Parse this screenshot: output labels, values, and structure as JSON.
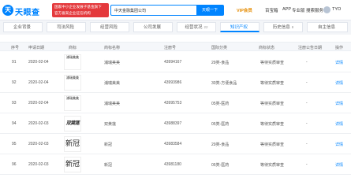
{
  "header": {
    "logo_mark": "天",
    "logo_text": "天眼查",
    "promo_line1": "国家中小企业发展子基金旗下",
    "promo_line2": "官方备案企业征信机构",
    "search_value": "中天金融集团公司",
    "search_button": "天眼一下",
    "nav_vip": "VIP会员",
    "nav_enterprise": "百宝箱",
    "nav_app": "APP",
    "nav_service": "专业版",
    "nav_more": "搜索服务",
    "nav_user": "TYO"
  },
  "tabs": [
    {
      "label": "企业背景",
      "count": ""
    },
    {
      "label": "司法风险",
      "count": ""
    },
    {
      "label": "经营风险",
      "count": ""
    },
    {
      "label": "公司发展",
      "count": ""
    },
    {
      "label": "经营状况",
      "count": "22"
    },
    {
      "label": "知识产权",
      "count": ""
    },
    {
      "label": "历史信息",
      "count": "8"
    },
    {
      "label": "自主信息",
      "count": ""
    }
  ],
  "table": {
    "headers": [
      "序号",
      "申请日期",
      "商标",
      "商标名称",
      "注册号",
      "国际分类",
      "商标状态",
      "注册公告日期",
      "操作"
    ],
    "rows": [
      {
        "no": "91",
        "date": "2020-02-04",
        "mark": "浦瑞美美",
        "mark_style": "v",
        "name": "浦瑞美美",
        "reg": "43994167",
        "class": "29类-食品",
        "status": "等待实质审查",
        "pub": "-",
        "op": "详情"
      },
      {
        "no": "92",
        "date": "2020-02-04",
        "mark": "浦瑞美美",
        "mark_style": "v",
        "name": "浦瑞美美",
        "reg": "43993986",
        "class": "30类-方便食品",
        "status": "等待实质审查",
        "pub": "-",
        "op": "详情"
      },
      {
        "no": "93",
        "date": "2020-02-04",
        "mark": "浦瑞美美",
        "mark_style": "v",
        "name": "浦瑞美美",
        "reg": "43995753",
        "class": "05类-医药",
        "status": "等待实质审查",
        "pub": "-",
        "op": "详情"
      },
      {
        "no": "94",
        "date": "2020-02-03",
        "mark": "双黄莲",
        "mark_style": "hand",
        "name": "双黄莲",
        "reg": "43988397",
        "class": "05类-医药",
        "status": "等待实质审查",
        "pub": "-",
        "op": "详情"
      },
      {
        "no": "95",
        "date": "2020-02-03",
        "mark": "新冠",
        "mark_style": "h",
        "name": "新冠",
        "reg": "43983584",
        "class": "29类-食品",
        "status": "等待实质审查",
        "pub": "-",
        "op": "详情"
      },
      {
        "no": "96",
        "date": "2020-02-03",
        "mark": "新冠",
        "mark_style": "h",
        "name": "新冠",
        "reg": "43981180",
        "class": "05类-医药",
        "status": "等待实质审查",
        "pub": "-",
        "op": "详情"
      }
    ]
  }
}
